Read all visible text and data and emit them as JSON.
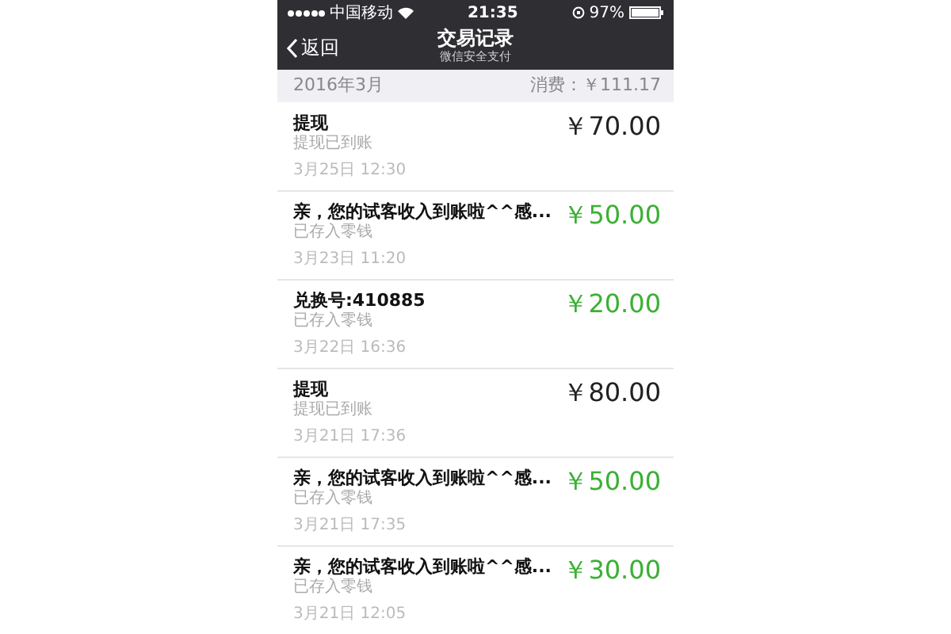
{
  "status_bar": {
    "carrier": "中国移动",
    "time": "21:35",
    "battery": "97%"
  },
  "nav": {
    "back": "返回",
    "title": "交易记录",
    "subtitle": "微信安全支付"
  },
  "month": {
    "label": "2016年3月",
    "spent_label": "消费：",
    "spent": "￥111.17"
  },
  "transactions": [
    {
      "title": "提现",
      "status": "提现已到账",
      "date": "3月25日 12:30",
      "amount": "￥70.00",
      "kind": "withdraw"
    },
    {
      "title": "亲，您的试客收入到账啦^^感...",
      "status": "已存入零钱",
      "date": "3月23日 11:20",
      "amount": "￥50.00",
      "kind": "income"
    },
    {
      "title": "兑换号:410885",
      "status": "已存入零钱",
      "date": "3月22日 16:36",
      "amount": "￥20.00",
      "kind": "income"
    },
    {
      "title": "提现",
      "status": "提现已到账",
      "date": "3月21日 17:36",
      "amount": "￥80.00",
      "kind": "withdraw"
    },
    {
      "title": "亲，您的试客收入到账啦^^感...",
      "status": "已存入零钱",
      "date": "3月21日 17:35",
      "amount": "￥50.00",
      "kind": "income"
    },
    {
      "title": "亲，您的试客收入到账啦^^感...",
      "status": "已存入零钱",
      "date": "3月21日 12:05",
      "amount": "￥30.00",
      "kind": "income"
    }
  ]
}
